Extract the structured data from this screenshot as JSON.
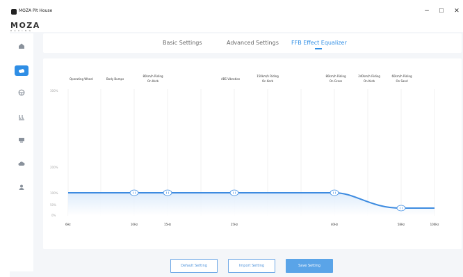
{
  "window": {
    "title": "MOZA Pit House",
    "minimize": "−",
    "maximize": "☐",
    "close": "✕"
  },
  "logo": {
    "main": "MOZA",
    "sub": "RACING"
  },
  "sidebar": {
    "items": [
      {
        "name": "home",
        "icon": "home-icon"
      },
      {
        "name": "wheelbase",
        "icon": "wheelbase-icon",
        "active": true
      },
      {
        "name": "steering-wheel",
        "icon": "steering-wheel-icon"
      },
      {
        "name": "pedals",
        "icon": "pedals-icon"
      },
      {
        "name": "dashboard",
        "icon": "dashboard-icon"
      },
      {
        "name": "cloud",
        "icon": "cloud-icon"
      },
      {
        "name": "user",
        "icon": "user-icon"
      }
    ]
  },
  "tabs": [
    {
      "label": "Basic Settings",
      "active": false
    },
    {
      "label": "Advanced Settings",
      "active": false
    },
    {
      "label": "FFB Effect Equalizer",
      "active": true
    }
  ],
  "equalizer": {
    "bands": [
      {
        "freq": "6Hz",
        "value": 100,
        "label_lines": [
          "Operating Wheel",
          "Body Bumps"
        ]
      },
      {
        "freq": "10Hz",
        "value": 100,
        "label_lines": [
          "80km/h Riding",
          "On Kerb"
        ]
      },
      {
        "freq": "15Hz",
        "value": 100,
        "label_lines": []
      },
      {
        "freq": "25Hz",
        "value": 100,
        "label_lines": [
          "ABS Vibration",
          "150km/h Riding",
          "On Kerb"
        ]
      },
      {
        "freq": "40Hz",
        "value": 100,
        "label_lines": [
          "80km/h Riding",
          "On Grass",
          "240km/h Riding",
          "On Kerb"
        ]
      },
      {
        "freq": "58Hz",
        "value": 40,
        "label_lines": [
          "60km/h Riding",
          "On Sand"
        ]
      },
      {
        "freq": "100Hz",
        "value": 40,
        "label_lines": []
      }
    ],
    "labels": {
      "operating_wheel": "Operating Wheel",
      "body_bumps": "Body Bumps",
      "kerb80_l1": "80km/h Riding",
      "kerb80_l2": "On Kerb",
      "abs": "ABS Vibration",
      "kerb150_l1": "150km/h Riding",
      "kerb150_l2": "On Kerb",
      "grass80_l1": "80km/h Riding",
      "grass80_l2": "On Grass",
      "kerb240_l1": "240km/h Riding",
      "kerb240_l2": "On Kerb",
      "sand60_l1": "60km/h Riding",
      "sand60_l2": "On Sand"
    },
    "y_ticks": [
      "300%",
      "200%",
      "100%",
      "50%",
      "0%"
    ],
    "x_ticks": [
      "6Hz",
      "10Hz",
      "15Hz",
      "25Hz",
      "40Hz",
      "58Hz",
      "100Hz"
    ],
    "colors": {
      "line": "#3d8be0",
      "fill": "#e8f2fc",
      "grid": "#f2f2f2"
    }
  },
  "buttons": {
    "default": "Default Setting",
    "import": "Import Setting",
    "save": "Save Setting"
  }
}
